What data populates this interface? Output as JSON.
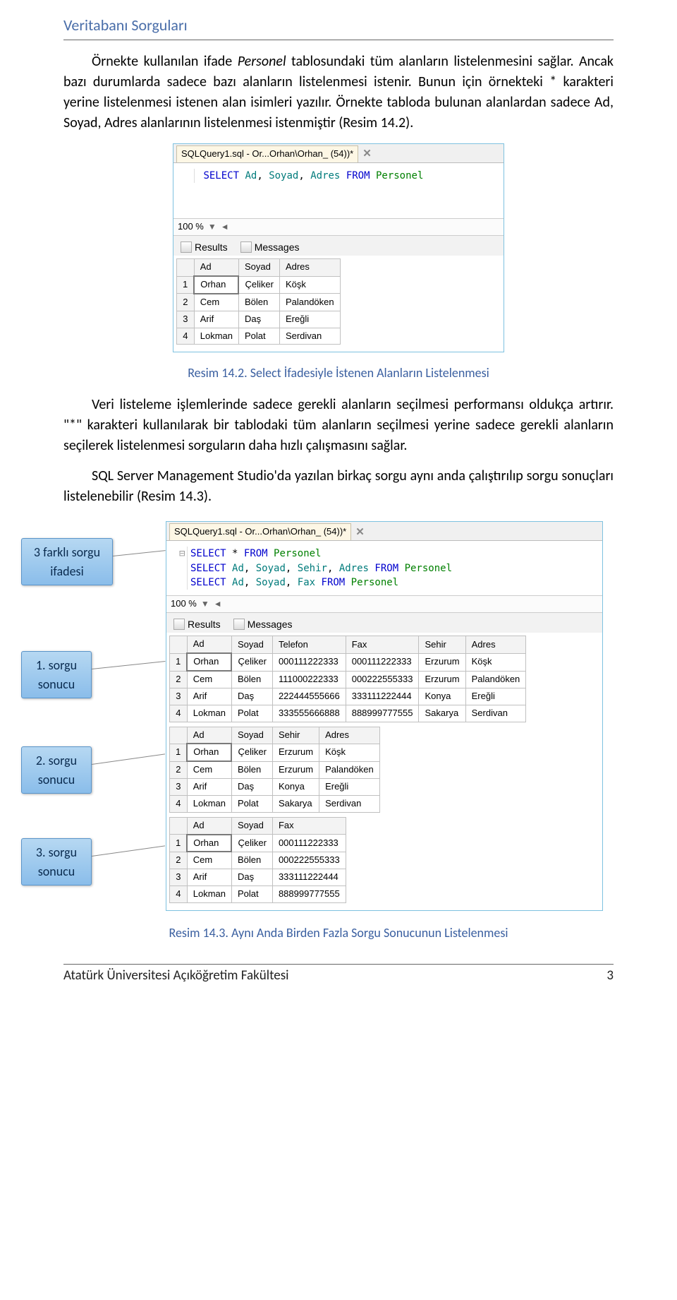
{
  "headerTitle": "Veritabanı Sorguları",
  "para1_a": "Örnekte kullanılan ifade ",
  "para1_ital": "Personel",
  "para1_b": " tablosundaki tüm alanların listelenmesini sağlar. Ancak bazı durumlarda sadece bazı alanların listelenmesi istenir. Bunun için örnekteki * karakteri yerine listelenmesi istenen alan isimleri yazılır. Örnekte tabloda bulunan alanlardan sadece Ad, Soyad, Adres alanlarının listelenmesi istenmiştir (Resim 14.2).",
  "fig1": {
    "tab": "SQLQuery1.sql - Or...Orhan\\Orhan_ (54))*",
    "codeParts": [
      "SELECT",
      "Ad",
      ",",
      "Soyad",
      ",",
      "Adres",
      "FROM",
      "Personel"
    ],
    "zoom": "100 %",
    "resultsLabel": "Results",
    "messagesLabel": "Messages",
    "headers": [
      "Ad",
      "Soyad",
      "Adres"
    ],
    "rows": [
      [
        "1",
        "Orhan",
        "Çeliker",
        "Köşk"
      ],
      [
        "2",
        "Cem",
        "Bölen",
        "Palandöken"
      ],
      [
        "3",
        "Arif",
        "Daş",
        "Ereğli"
      ],
      [
        "4",
        "Lokman",
        "Polat",
        "Serdivan"
      ]
    ]
  },
  "caption1": "Resim 14.2. Select İfadesiyle İstenen Alanların Listelenmesi",
  "para2": "Veri listeleme işlemlerinde sadece gerekli alanların seçilmesi performansı oldukça artırır. \"*\" karakteri kullanılarak bir tablodaki tüm alanların seçilmesi yerine sadece gerekli alanların seçilerek listelenmesi sorguların daha hızlı çalışmasını sağlar.",
  "para3": "SQL Server Management Studio'da yazılan birkaç sorgu aynı anda çalıştırılıp sorgu sonuçları listelenebilir (Resim 14.3).",
  "callouts": {
    "c1": "3 farklı sorgu ifadesi",
    "c2": "1. sorgu sonucu",
    "c3": "2. sorgu sonucu",
    "c4": "3. sorgu sonucu"
  },
  "fig2": {
    "tab": "SQLQuery1.sql - Or...Orhan\\Orhan_ (54))*",
    "zoom": "100 %",
    "resultsLabel": "Results",
    "messagesLabel": "Messages",
    "code": {
      "l1a": "SELECT",
      "l1b": "*",
      "l1c": "FROM",
      "l1d": "Personel",
      "l2a": "SELECT",
      "l2b": "Ad",
      "l2c": "Soyad",
      "l2d": "Sehir",
      "l2e": "Adres",
      "l2f": "FROM",
      "l2g": "Personel",
      "l3a": "SELECT",
      "l3b": "Ad",
      "l3c": "Soyad",
      "l3d": "Fax",
      "l3e": "FROM",
      "l3f": "Personel"
    },
    "grids": [
      {
        "headers": [
          "Ad",
          "Soyad",
          "Telefon",
          "Fax",
          "Sehir",
          "Adres"
        ],
        "rows": [
          [
            "1",
            "Orhan",
            "Çeliker",
            "000111222333",
            "000111222333",
            "Erzurum",
            "Köşk"
          ],
          [
            "2",
            "Cem",
            "Bölen",
            "111000222333",
            "000222555333",
            "Erzurum",
            "Palandöken"
          ],
          [
            "3",
            "Arif",
            "Daş",
            "222444555666",
            "333111222444",
            "Konya",
            "Ereğli"
          ],
          [
            "4",
            "Lokman",
            "Polat",
            "333555666888",
            "888999777555",
            "Sakarya",
            "Serdivan"
          ]
        ]
      },
      {
        "headers": [
          "Ad",
          "Soyad",
          "Sehir",
          "Adres"
        ],
        "rows": [
          [
            "1",
            "Orhan",
            "Çeliker",
            "Erzurum",
            "Köşk"
          ],
          [
            "2",
            "Cem",
            "Bölen",
            "Erzurum",
            "Palandöken"
          ],
          [
            "3",
            "Arif",
            "Daş",
            "Konya",
            "Ereğli"
          ],
          [
            "4",
            "Lokman",
            "Polat",
            "Sakarya",
            "Serdivan"
          ]
        ]
      },
      {
        "headers": [
          "Ad",
          "Soyad",
          "Fax"
        ],
        "rows": [
          [
            "1",
            "Orhan",
            "Çeliker",
            "000111222333"
          ],
          [
            "2",
            "Cem",
            "Bölen",
            "000222555333"
          ],
          [
            "3",
            "Arif",
            "Daş",
            "333111222444"
          ],
          [
            "4",
            "Lokman",
            "Polat",
            "888999777555"
          ]
        ]
      }
    ]
  },
  "caption2": "Resim 14.3. Aynı Anda Birden Fazla Sorgu Sonucunun Listelenmesi",
  "footerLeft": "Atatürk Üniversitesi Açıköğretim Fakültesi",
  "footerRight": "3"
}
